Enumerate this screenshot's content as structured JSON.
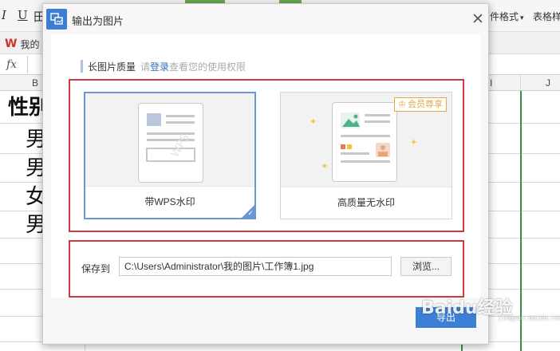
{
  "ribbon": {
    "italic_label": "I",
    "underline_label": "U",
    "border_label": "田",
    "cell_format_label": "件格式",
    "cell_format_arrow": "▾",
    "table_style_label": "表格样"
  },
  "tabs": {
    "doc_tab_label": "我的"
  },
  "formula_bar": {
    "fx_label": "fx"
  },
  "columns": {
    "b": "B",
    "i": "I",
    "j": "J"
  },
  "cells": {
    "header": "性别",
    "row1": "男",
    "row2": "男",
    "row3": "女",
    "row4": "男"
  },
  "dialog": {
    "title": "输出为图片",
    "close_label": "×",
    "quality": {
      "label": "长图片质量",
      "hint_prefix": "请",
      "hint_link": "登录",
      "hint_suffix": "查看您的使用权限"
    },
    "options": [
      {
        "label": "带WPS水印",
        "selected": true,
        "watermark_text": "WPS"
      },
      {
        "label": "高质量无水印",
        "selected": false,
        "badge": "会员尊享"
      }
    ],
    "save": {
      "label": "保存到",
      "path": "C:\\Users\\Administrator\\我的图片\\工作簿1.jpg",
      "browse_label": "浏览..."
    },
    "ok_label": "导出"
  },
  "watermark": {
    "brand": "Baidu经验",
    "url": "jingyan.baidu.com"
  },
  "colors": {
    "accent_blue": "#3c7fd4",
    "highlight_red": "#d0393e",
    "vip_gold": "#e3a74a",
    "selection_green": "#3c8f3c"
  }
}
